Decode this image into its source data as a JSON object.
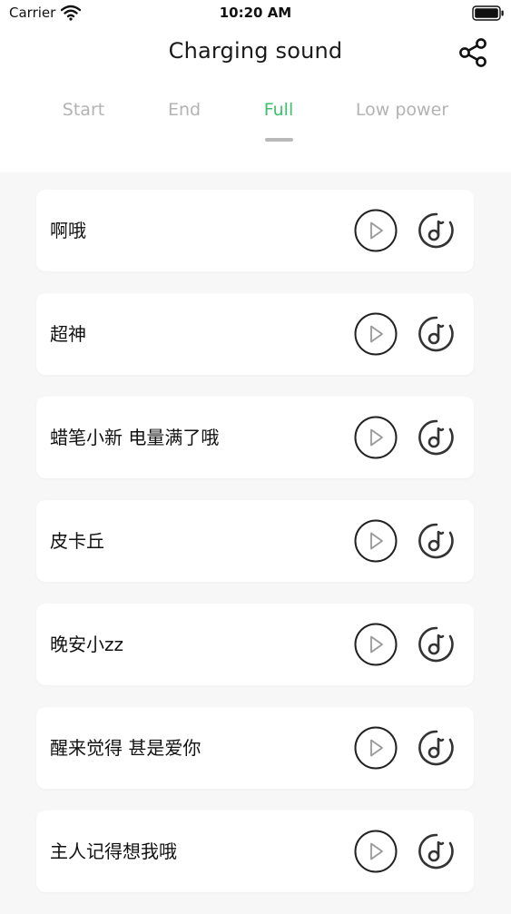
{
  "status_bar": {
    "carrier": "Carrier",
    "time": "10:20 AM",
    "wifi_icon": "wifi-icon",
    "battery_icon": "battery-icon"
  },
  "header": {
    "title": "Charging sound",
    "share_icon": "share-icon"
  },
  "tabs": [
    {
      "label": "Start",
      "active": false
    },
    {
      "label": "End",
      "active": false
    },
    {
      "label": "Full",
      "active": true
    },
    {
      "label": "Low power",
      "active": false
    }
  ],
  "sounds": [
    {
      "title": "啊哦"
    },
    {
      "title": "超神"
    },
    {
      "title": "蜡笔小新 电量满了哦"
    },
    {
      "title": "皮卡丘"
    },
    {
      "title": "晚安小zz"
    },
    {
      "title": "醒来觉得 甚是爱你"
    },
    {
      "title": "主人记得想我哦"
    }
  ],
  "icons": {
    "play": "play-icon",
    "set_ringtone": "music-note-icon"
  },
  "colors": {
    "accent": "#3dbf6b",
    "tab_inactive": "#b3b3b3",
    "indicator": "#b9b9b9",
    "background": "#f7f7f7",
    "card": "#ffffff",
    "icon_stroke": "#333333"
  }
}
